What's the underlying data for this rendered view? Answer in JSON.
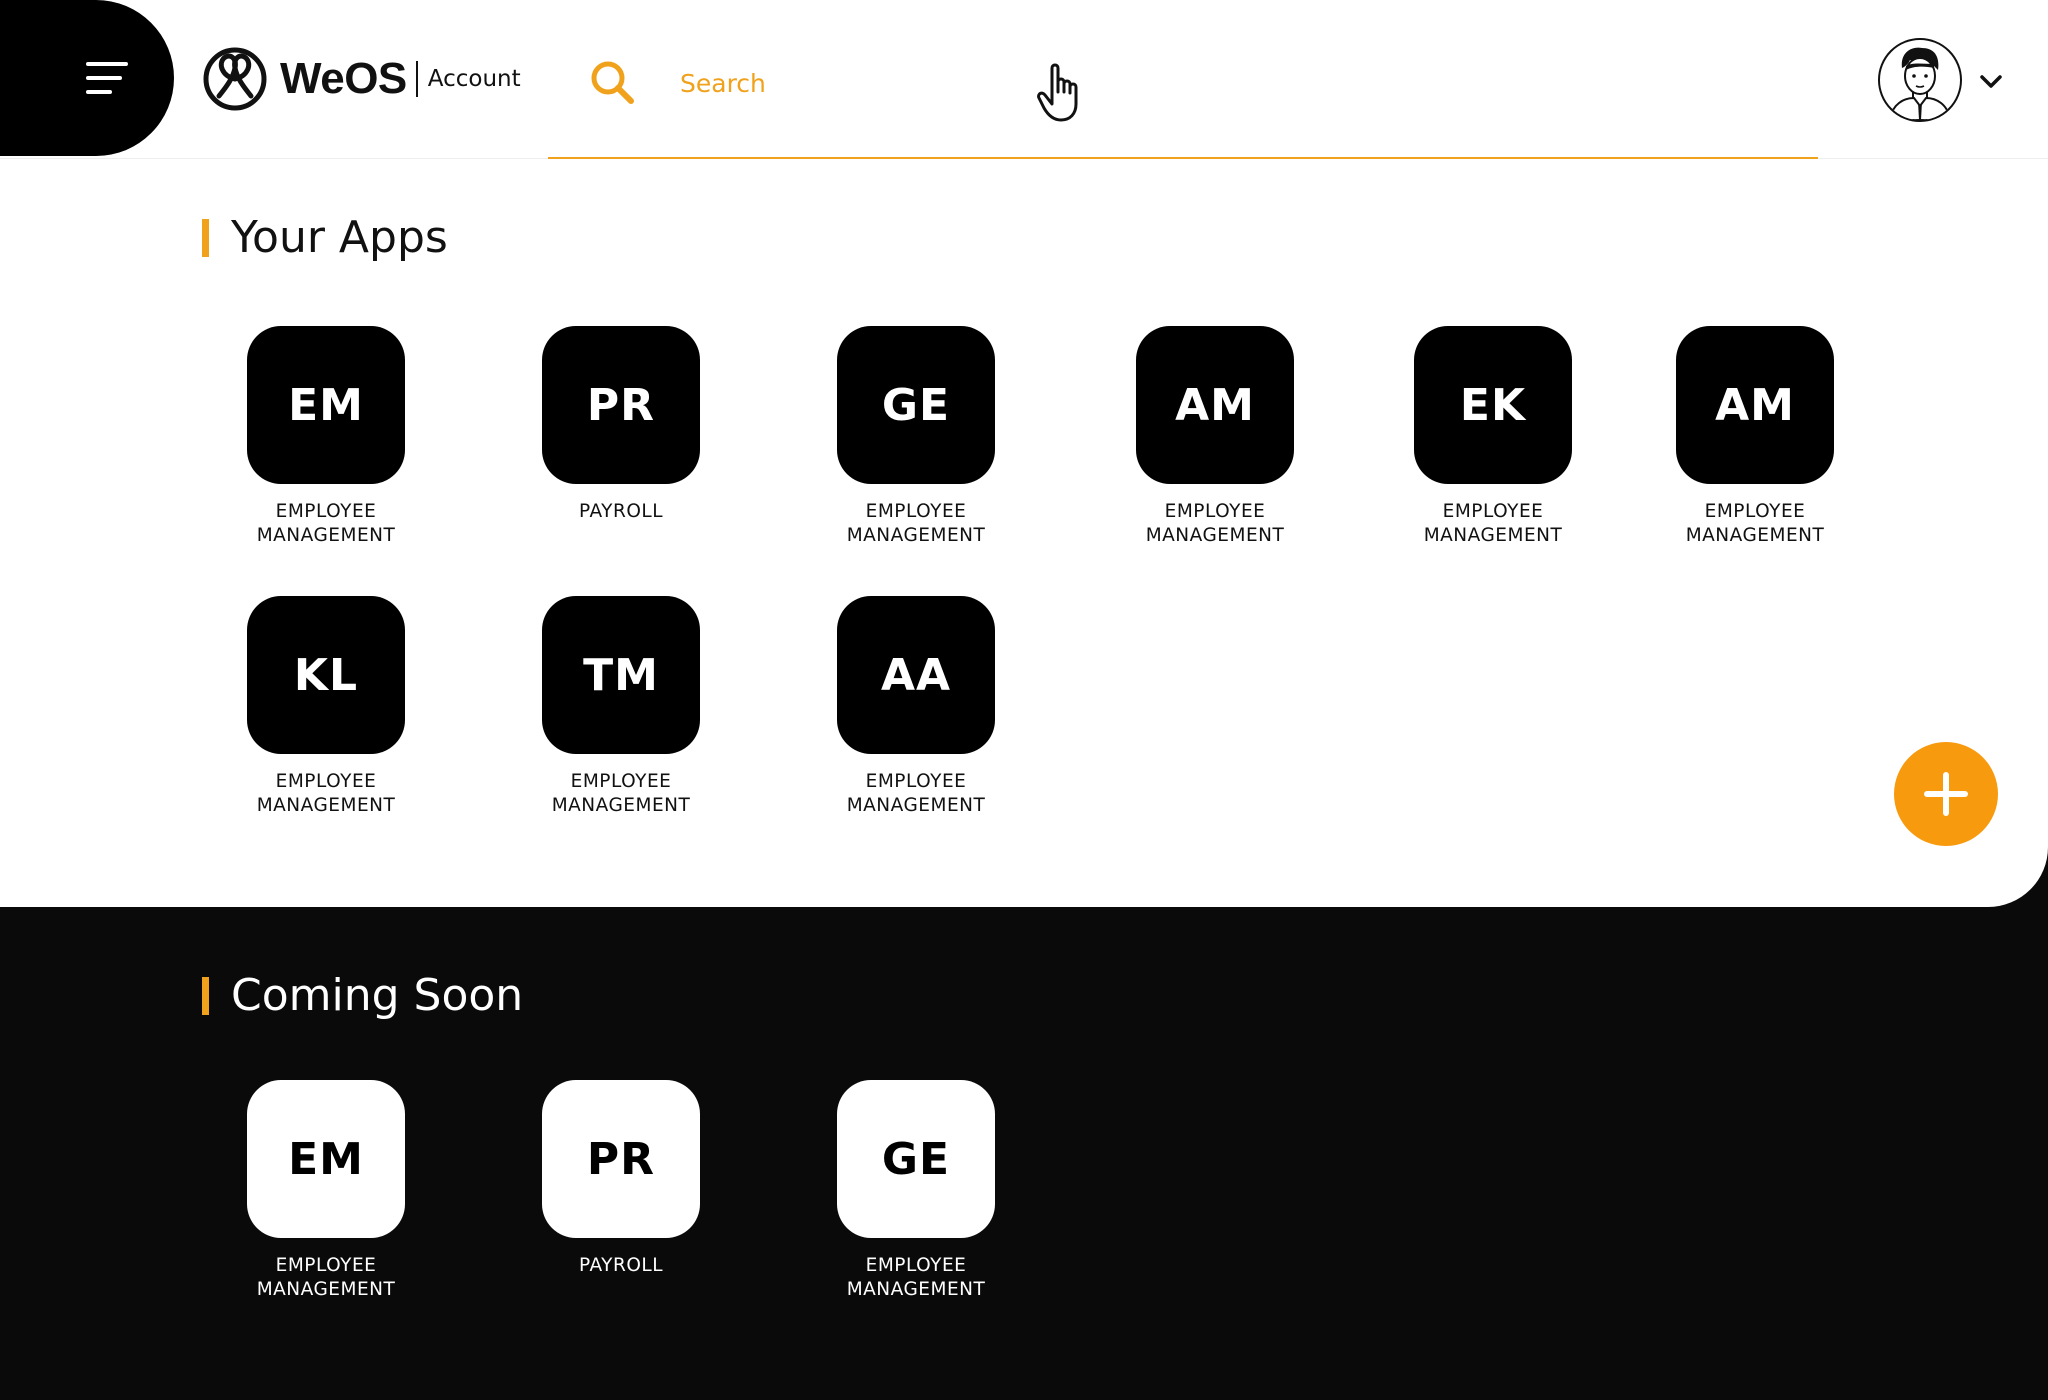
{
  "header": {
    "brand": "WeOS",
    "brand_sub": "Account",
    "search_placeholder": "Search",
    "icons": {
      "menu": "menu-icon",
      "logo": "weos-logo-icon",
      "search": "search-icon",
      "cursor": "hand-pointer-icon",
      "avatar": "user-avatar",
      "chevron": "chevron-down-icon"
    }
  },
  "your_apps": {
    "title": "Your Apps",
    "apps": [
      {
        "initials": "EM",
        "label": "EMPLOYEE\nMANAGEMENT"
      },
      {
        "initials": "PR",
        "label": "PAYROLL"
      },
      {
        "initials": "GE",
        "label": "EMPLOYEE\nMANAGEMENT"
      },
      {
        "initials": "AM",
        "label": "EMPLOYEE\nMANAGEMENT"
      },
      {
        "initials": "EK",
        "label": "EMPLOYEE\nMANAGEMENT"
      },
      {
        "initials": "AM",
        "label": "EMPLOYEE\nMANAGEMENT"
      },
      {
        "initials": "KL",
        "label": "EMPLOYEE\nMANAGEMENT"
      },
      {
        "initials": "TM",
        "label": "EMPLOYEE\nMANAGEMENT"
      },
      {
        "initials": "AA",
        "label": "EMPLOYEE\nMANAGEMENT"
      }
    ]
  },
  "coming_soon": {
    "title": "Coming Soon",
    "apps": [
      {
        "initials": "EM",
        "label": "EMPLOYEE\nMANAGEMENT"
      },
      {
        "initials": "PR",
        "label": "PAYROLL"
      },
      {
        "initials": "GE",
        "label": "EMPLOYEE\nMANAGEMENT"
      }
    ]
  },
  "fab": {
    "icon": "plus-icon"
  },
  "colors": {
    "accent": "#f79a0e",
    "search_accent": "#f0a21c",
    "dark": "#000000",
    "background_dark": "#0a0a0a",
    "background_light": "#ffffff"
  }
}
